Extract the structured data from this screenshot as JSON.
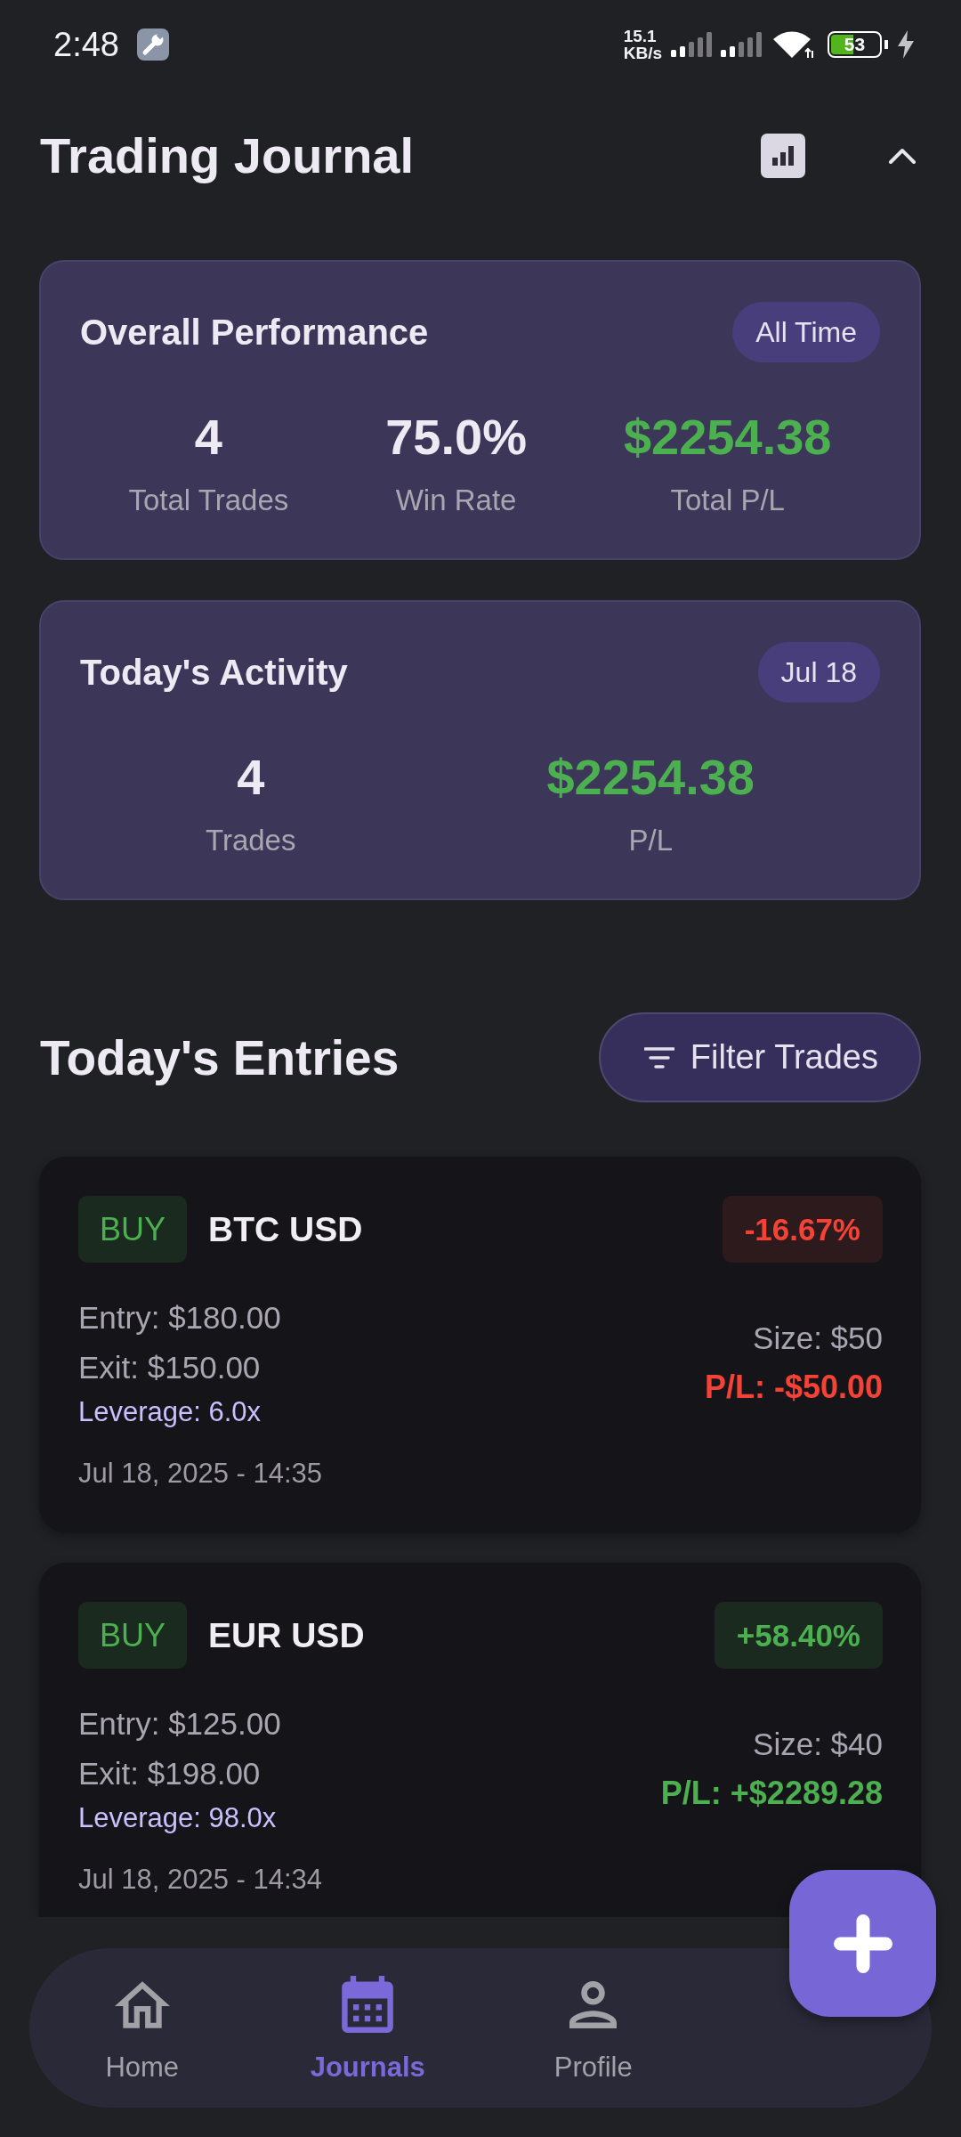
{
  "status_bar": {
    "time": "2:48",
    "network_speed": "15.1",
    "network_speed_unit": "KB/s",
    "battery": "53"
  },
  "header": {
    "title": "Trading Journal",
    "summary_expanded": true
  },
  "summary_cards": [
    {
      "title": "Overall Performance",
      "period": "All Time",
      "stats": [
        {
          "value": "4",
          "label": "Total Trades",
          "gain": false
        },
        {
          "value": "75.0%",
          "label": "Win Rate",
          "gain": false
        },
        {
          "value": "$2254.38",
          "label": "Total P/L",
          "gain": true
        }
      ]
    },
    {
      "title": "Today's Activity",
      "period": "Jul 18",
      "stats": [
        {
          "value": "4",
          "label": "Trades",
          "gain": false
        },
        {
          "value": "$2254.38",
          "label": "P/L",
          "gain": true
        }
      ]
    }
  ],
  "entries": {
    "title": "Today's Entries",
    "filter_button": "Filter Trades",
    "trades": [
      {
        "side": {
          "label": "BUY",
          "kind": "buy"
        },
        "pair": "BTC USD",
        "change": "-16.67%",
        "gain": false,
        "entry": "Entry: $180.00",
        "exit": "Exit: $150.00",
        "leverage": "Leverage: 6.0x",
        "size": "Size: $50",
        "pnl": "P/L: -$50.00",
        "date": "Jul 18, 2025 - 14:35"
      },
      {
        "side": {
          "label": "BUY",
          "kind": "buy"
        },
        "pair": "EUR USD",
        "change": "+58.40%",
        "gain": true,
        "entry": "Entry: $125.00",
        "exit": "Exit: $198.00",
        "leverage": "Leverage: 98.0x",
        "size": "Size: $40",
        "pnl": "P/L: +$2289.28",
        "date": "Jul 18, 2025 - 14:34"
      }
    ]
  },
  "bottom_nav": {
    "items": [
      {
        "label": "Home",
        "selected": false
      },
      {
        "label": "Journals",
        "selected": true
      },
      {
        "label": "Profile",
        "selected": false
      }
    ]
  }
}
